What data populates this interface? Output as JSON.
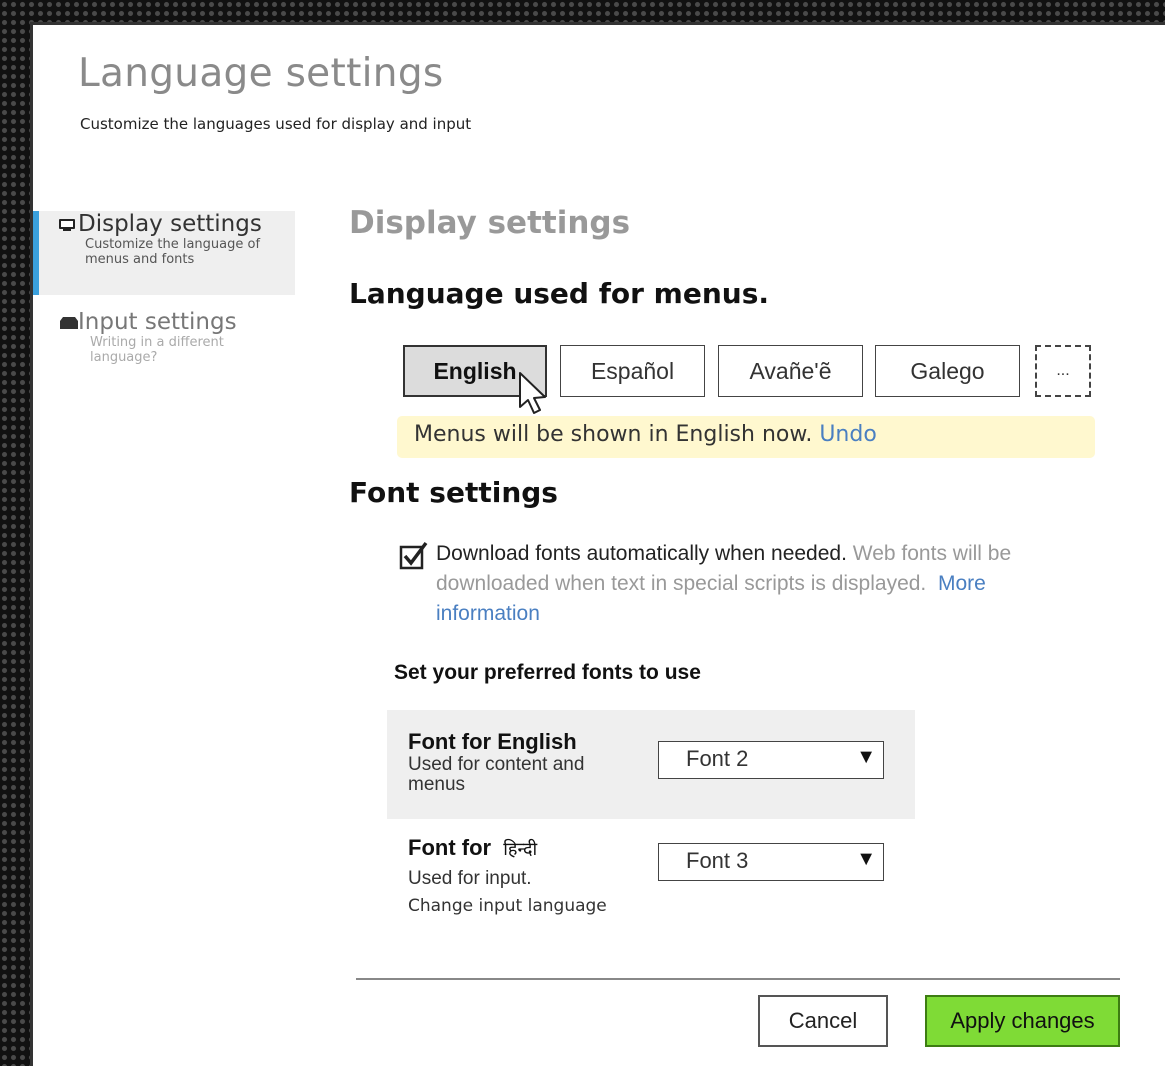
{
  "header": {
    "title": "Language settings",
    "subtitle": "Customize the languages used for display and input"
  },
  "sidebar": {
    "items": [
      {
        "label": "Display settings",
        "description": "Customize the language of menus and fonts",
        "icon": "display-icon",
        "active": true
      },
      {
        "label": "Input settings",
        "description": "Writing in a different language?",
        "icon": "keyboard-icon",
        "active": false
      }
    ]
  },
  "display": {
    "heading": "Display settings",
    "menus_heading": "Language used for menus.",
    "languages": [
      {
        "label": "English",
        "selected": true
      },
      {
        "label": "Español",
        "selected": false
      },
      {
        "label": "Avañe'ẽ",
        "selected": false
      },
      {
        "label": "Galego",
        "selected": false
      }
    ],
    "more_label": "...",
    "notice_text": "Menus will be shown in English now.",
    "notice_link": "Undo"
  },
  "fonts": {
    "heading": "Font settings",
    "auto_download": {
      "checked": true,
      "label": "Download fonts automatically when needed.",
      "description": "Web fonts will be downloaded when text in special scripts is displayed.",
      "link": "More information"
    },
    "preferred_heading": "Set your preferred fonts to use",
    "rows": [
      {
        "label": "Font for English",
        "description": "Used for content and menus",
        "value": "Font 2"
      },
      {
        "label": "Font for",
        "script": "हिन्दी",
        "description": "Used for input.",
        "link": "Change input language",
        "value": "Font 3"
      }
    ]
  },
  "footer": {
    "cancel": "Cancel",
    "apply": "Apply changes"
  },
  "colors": {
    "accent": "#3aa0dd",
    "apply": "#7fdb36",
    "notice": "#fff8cf",
    "link": "#4a7fc1"
  }
}
